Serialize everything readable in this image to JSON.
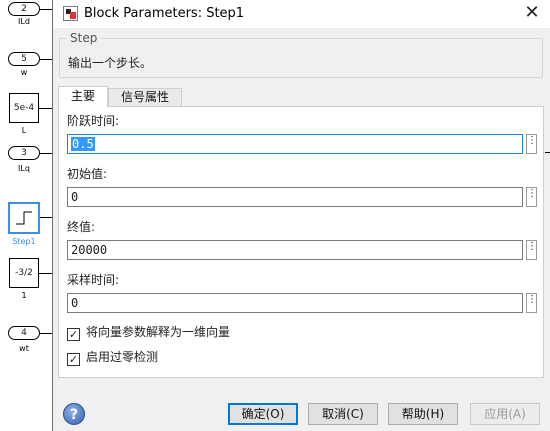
{
  "canvas": {
    "blocks": [
      {
        "value": "2",
        "label": "ILd"
      },
      {
        "value": "5",
        "label": "w"
      },
      {
        "value": "5e-4",
        "label": "L"
      },
      {
        "value": "3",
        "label": "ILq"
      },
      {
        "value": "",
        "label": "Step1"
      },
      {
        "value": "-3/2",
        "label": "1"
      },
      {
        "value": "4",
        "label": "wt"
      }
    ]
  },
  "dialog": {
    "title": "Block Parameters: Step1",
    "close_glyph": "✕",
    "group": {
      "legend": "Step",
      "description": "输出一个步长。"
    },
    "tabs": [
      {
        "label": "主要",
        "active": true
      },
      {
        "label": "信号属性",
        "active": false
      }
    ],
    "fields": [
      {
        "label": "阶跃时间:",
        "value": "0.5",
        "selected": true
      },
      {
        "label": "初始值:",
        "value": "0"
      },
      {
        "label": "终值:",
        "value": "20000"
      },
      {
        "label": "采样时间:",
        "value": "0"
      }
    ],
    "checkboxes": [
      {
        "label": "将向量参数解释为一维向量",
        "checked": true
      },
      {
        "label": "启用过零检测",
        "checked": true
      }
    ],
    "buttons": {
      "ok": "确定(O)",
      "cancel": "取消(C)",
      "help": "帮助(H)",
      "apply": "应用(A)"
    },
    "help_icon": "?"
  }
}
